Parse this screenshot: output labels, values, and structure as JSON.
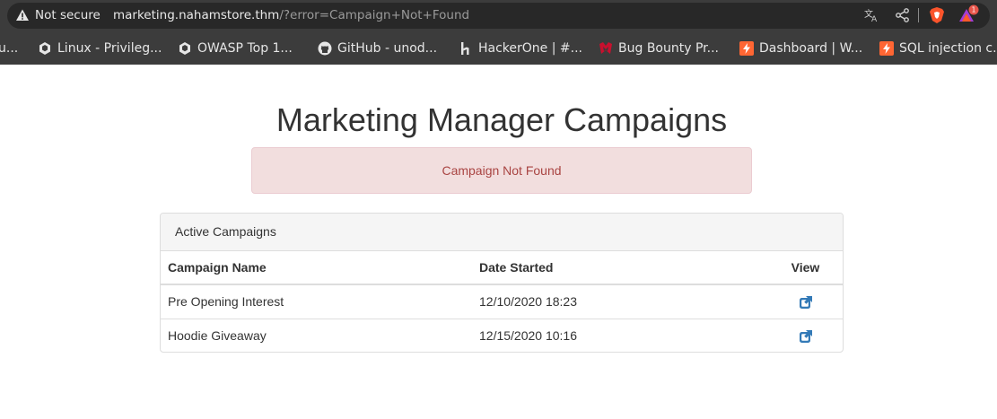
{
  "browser": {
    "security_label": "Not secure",
    "url_host": "marketing.nahamstore.thm",
    "url_rest": "/?error=Campaign+Not+Found",
    "extension_badge": "1",
    "bookmarks": [
      {
        "label": "u...",
        "icon": "truncated-favicon"
      },
      {
        "label": "Linux - Privileg...",
        "icon": "hackthebox-icon"
      },
      {
        "label": "OWASP Top 1...",
        "icon": "hackthebox-icon"
      },
      {
        "label": "GitHub - unod...",
        "icon": "github-icon"
      },
      {
        "label": "HackerOne | #...",
        "icon": "hackerone-icon"
      },
      {
        "label": "Bug Bounty Pr...",
        "icon": "bugcrowd-icon"
      },
      {
        "label": "Dashboard | W...",
        "icon": "portswigger-icon"
      },
      {
        "label": "SQL injection c...",
        "icon": "portswigger-icon"
      }
    ]
  },
  "page": {
    "title": "Marketing Manager Campaigns",
    "alert_text": "Campaign Not Found"
  },
  "panel": {
    "heading": "Active Campaigns",
    "columns": [
      "Campaign Name",
      "Date Started",
      "View"
    ],
    "rows": [
      {
        "name": "Pre Opening Interest",
        "date": "12/10/2020 18:23",
        "view_icon": "external-link-icon"
      },
      {
        "name": "Hoodie Giveaway",
        "date": "12/15/2020 10:16",
        "view_icon": "external-link-icon"
      }
    ]
  },
  "colors": {
    "chrome_bg": "#3c3c3c",
    "omnibox_bg": "#282828",
    "alert_bg": "#f2dede",
    "alert_text": "#a94442",
    "link": "#337ab7",
    "brave_orange": "#fb542b"
  }
}
